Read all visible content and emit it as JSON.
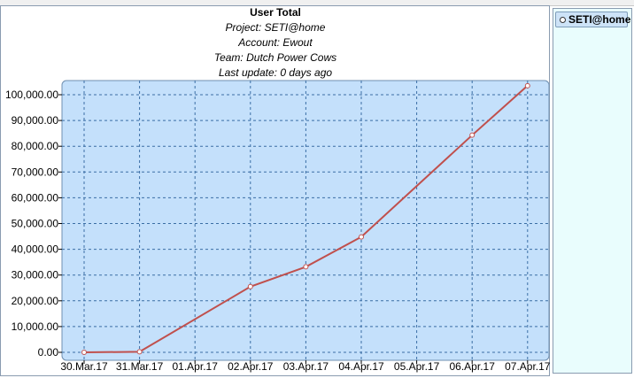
{
  "chart_data": {
    "type": "line",
    "title": "User Total",
    "subtitles": [
      "Project: SETI@home",
      "Account: Ewout",
      "Team: Dutch Power Cows",
      "Last update: 0 days ago"
    ],
    "categories": [
      "30.Mar.17",
      "31.Mar.17",
      "01.Apr.17",
      "02.Apr.17",
      "03.Apr.17",
      "04.Apr.17",
      "05.Apr.17",
      "06.Apr.17",
      "07.Apr.17"
    ],
    "x_marked_index": [
      0,
      1,
      3,
      4,
      5,
      7,
      8
    ],
    "series": [
      {
        "name": "SETI@home",
        "values": [
          0,
          200,
          null,
          25500,
          33200,
          44800,
          null,
          84300,
          103500
        ]
      }
    ],
    "y_ticks": [
      "0.00",
      "10,000.00",
      "20,000.00",
      "30,000.00",
      "40,000.00",
      "50,000.00",
      "60,000.00",
      "70,000.00",
      "80,000.00",
      "90,000.00",
      "100,000.00"
    ],
    "ylim": [
      0,
      103500
    ],
    "grid": true,
    "legend_placement": "right",
    "colors": {
      "plot_background": "#c4e0fb",
      "grid": "#3b6ea5",
      "line": "#c0504d",
      "legend_background": "#e9fdfd"
    }
  },
  "legend": {
    "label": "SETI@home"
  }
}
